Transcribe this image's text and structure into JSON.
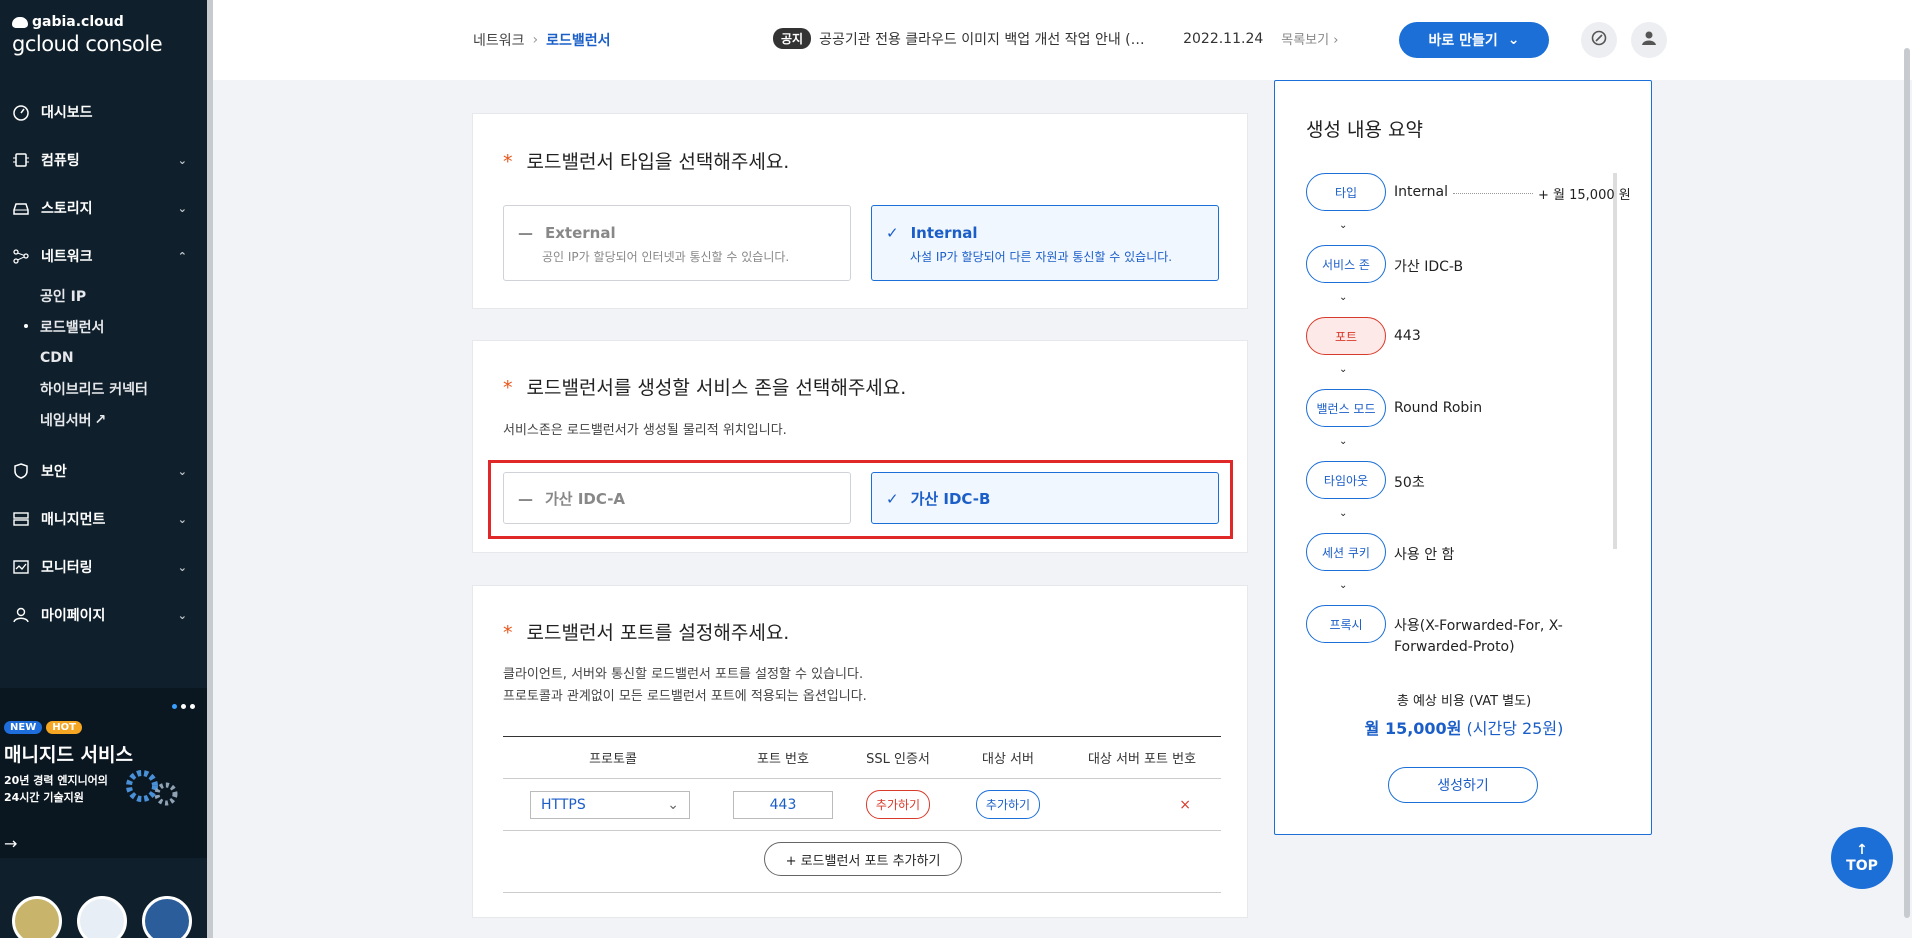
{
  "sidebar": {
    "brand": "gabia.cloud",
    "console": "gcloud console",
    "items": [
      {
        "label": "대시보드",
        "icon": "dashboard-icon",
        "chevron": ""
      },
      {
        "label": "컴퓨팅",
        "icon": "chip-icon",
        "chevron": "⌄"
      },
      {
        "label": "스토리지",
        "icon": "storage-icon",
        "chevron": "⌄"
      },
      {
        "label": "네트워크",
        "icon": "network-icon",
        "chevron": "⌃"
      },
      {
        "label": "보안",
        "icon": "shield-icon",
        "chevron": "⌄"
      },
      {
        "label": "매니지먼트",
        "icon": "management-icon",
        "chevron": "⌄"
      },
      {
        "label": "모니터링",
        "icon": "monitoring-icon",
        "chevron": "⌄"
      },
      {
        "label": "마이페이지",
        "icon": "user-icon",
        "chevron": "⌄"
      }
    ],
    "network_sub": [
      "공인 IP",
      "로드밸런서",
      "CDN",
      "하이브리드 커넥터",
      "네임서버"
    ],
    "promo": {
      "badge_new": "NEW",
      "badge_hot": "HOT",
      "title": "매니지드 서비스",
      "desc1": "20년 경력 엔지니어의",
      "desc2": "24시간 기술지원"
    }
  },
  "header": {
    "breadcrumb_parent": "네트워크",
    "breadcrumb_current": "로드밸런서",
    "notice_tag": "공지",
    "notice_text": "공공기관 전용 클라우드 이미지 백업 개선 작업 안내 (…",
    "notice_date": "2022.11.24",
    "notice_more": "목록보기",
    "make_button": "바로 만들기"
  },
  "type_section": {
    "title": "로드밸런서 타입을 선택해주세요.",
    "options": [
      {
        "label": "External",
        "desc": "공인 IP가 할당되어 인터넷과 통신할 수 있습니다.",
        "selected": false
      },
      {
        "label": "Internal",
        "desc": "사설 IP가 할당되어 다른 자원과 통신할 수 있습니다.",
        "selected": true
      }
    ]
  },
  "zone_section": {
    "title": "로드밸런서를 생성할 서비스 존을 선택해주세요.",
    "help": "서비스존은 로드밸런서가 생성될 물리적 위치입니다.",
    "options": [
      {
        "label": "가산 IDC-A",
        "selected": false
      },
      {
        "label": "가산 IDC-B",
        "selected": true
      }
    ]
  },
  "port_section": {
    "title": "로드밸런서 포트를 설정해주세요.",
    "help1": "클라이언트, 서버와 통신할 로드밸런서 포트를 설정할 수 있습니다.",
    "help2": "프로토콜과 관계없이 모든 로드밸런서 포트에 적용되는 옵션입니다.",
    "columns": [
      "프로토콜",
      "포트 번호",
      "SSL 인증서",
      "대상 서버",
      "대상 서버 포트 번호"
    ],
    "row": {
      "protocol": "HTTPS",
      "port": "443",
      "ssl_button": "추가하기",
      "server_button": "추가하기",
      "delete": "×"
    },
    "add_button": "+ 로드밸런서 포트 추가하기"
  },
  "summary": {
    "title": "생성 내용 요약",
    "steps": [
      {
        "label": "타입",
        "value": "Internal",
        "price": "+ 월 15,000 원"
      },
      {
        "label": "서비스 존",
        "value": "가산 IDC-B"
      },
      {
        "label": "포트",
        "value": "443"
      },
      {
        "label": "밸런스 모드",
        "value": "Round Robin"
      },
      {
        "label": "타임아웃",
        "value": "50초"
      },
      {
        "label": "세션 쿠키",
        "value": "사용 안 함"
      },
      {
        "label": "프록시",
        "value": "사용(X-Forwarded-For, X-Forwarded-Proto)"
      }
    ],
    "total_label": "총 예상 비용 (VAT 별도)",
    "total_value": "월 15,000원",
    "total_hourly": "(시간당 25원)",
    "create_button": "생성하기"
  },
  "top_button": "TOP",
  "colors": {
    "accent": "#1b6fd6",
    "required": "#e8561a",
    "danger": "#d83a2b",
    "sidebar": "#0f1f2b"
  }
}
